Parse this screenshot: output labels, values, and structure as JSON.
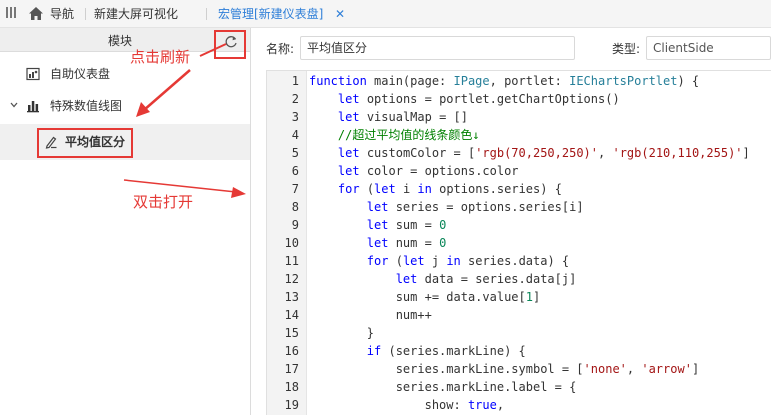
{
  "tabs": {
    "nav_label": "导航",
    "new_screen": "新建大屏可视化",
    "active_tab": "宏管理[新建仪表盘]",
    "close_symbol": "✕"
  },
  "left_panel": {
    "header_title": "模块",
    "tree": {
      "item_dashboard": "自助仪表盘",
      "item_group": "特殊数值线图",
      "item_macro": "平均值区分"
    }
  },
  "annotations": {
    "refresh_hint": "点击刷新",
    "open_hint": "双击打开"
  },
  "form": {
    "name_label": "名称:",
    "name_value": "平均值区分",
    "type_label": "类型:",
    "type_value": "ClientSide"
  },
  "editor": {
    "line_numbers": [
      "1",
      "2",
      "3",
      "4",
      "5",
      "6",
      "7",
      "8",
      "9",
      "10",
      "11",
      "12",
      "13",
      "14",
      "15",
      "16",
      "17",
      "18",
      "19"
    ]
  },
  "colors": {
    "accent_blue": "#2f7fd8",
    "annotation_red": "#e53935",
    "keyword": "#0000ff",
    "string": "#a31515",
    "number": "#098658",
    "comment": "#008000",
    "type": "#267f99"
  }
}
